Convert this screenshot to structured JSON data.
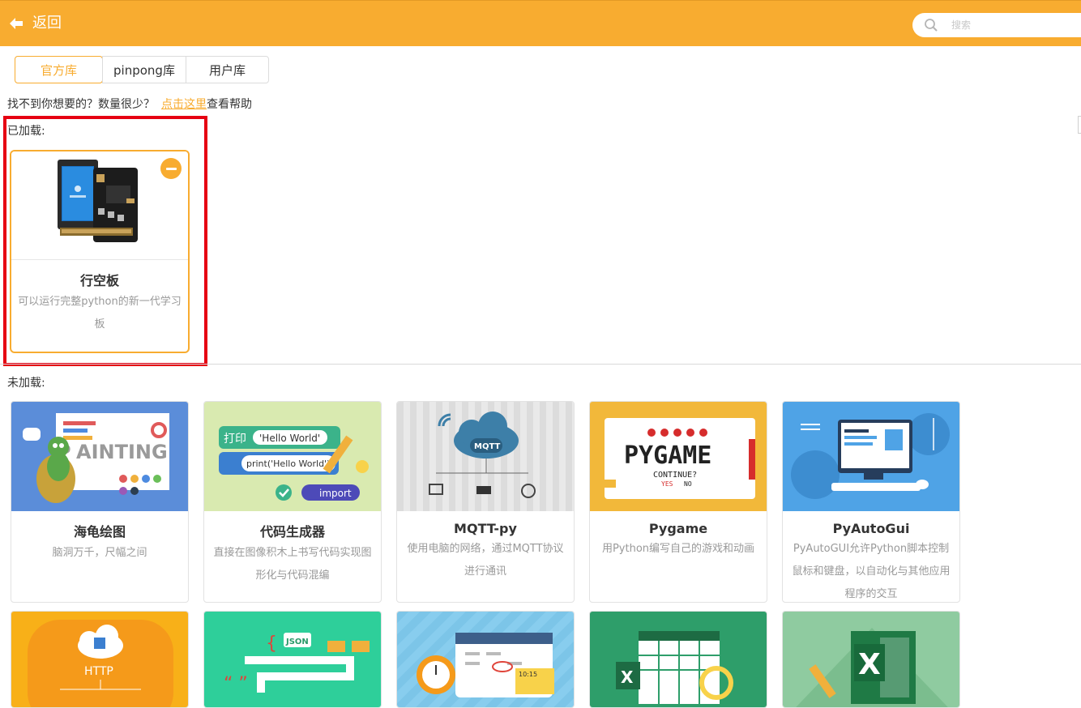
{
  "header": {
    "back_label": "返回",
    "search_placeholder": "搜索",
    "background_color": "#f8ac30"
  },
  "tabs": [
    {
      "label": "官方库",
      "active": true
    },
    {
      "label": "pinpong库",
      "active": false
    },
    {
      "label": "用户库",
      "active": false
    }
  ],
  "help": {
    "prefix": "找不到你想要的？数量很少？",
    "link": "点击这里",
    "suffix": "查看帮助"
  },
  "sections": {
    "loaded_label": "已加载:",
    "unloaded_label": "未加载:"
  },
  "loaded": [
    {
      "title": "行空板",
      "desc": "可以运行完整python的新一代学习板",
      "icon": "unihiker-board-image"
    }
  ],
  "unloaded": [
    {
      "title": "海龟绘图",
      "desc": "脑洞万千，尺幅之间",
      "icon": "turtle-painting-image"
    },
    {
      "title": "代码生成器",
      "desc": "直接在图像积木上书写代码实现图形化与代码混编",
      "icon": "code-generator-image",
      "thumb_texts": [
        "打印",
        "'Hello World'",
        "print('Hello World')",
        "import"
      ]
    },
    {
      "title": "MQTT-py",
      "desc": "使用电脑的网络，通过MQTT协议进行通讯",
      "icon": "mqtt-cloud-image",
      "thumb_texts": [
        "MQTT"
      ]
    },
    {
      "title": "Pygame",
      "desc": "用Python编写自己的游戏和动画",
      "icon": "pygame-image",
      "thumb_texts": [
        "PYGAME",
        "CONTINUE?",
        "YES",
        "NO"
      ]
    },
    {
      "title": "PyAutoGui",
      "desc": "PyAutoGUI允许Python脚本控制鼠标和键盘，以自动化与其他应用程序的交互",
      "icon": "pyautogui-image"
    },
    {
      "title": "",
      "desc": "",
      "icon": "http-image",
      "thumb_texts": [
        "HTTP"
      ]
    },
    {
      "title": "",
      "desc": "",
      "icon": "json-image",
      "thumb_texts": [
        "JSON"
      ]
    },
    {
      "title": "",
      "desc": "",
      "icon": "calendar-clock-image",
      "thumb_texts": [
        "10:15"
      ]
    },
    {
      "title": "",
      "desc": "",
      "icon": "excel-search-image"
    },
    {
      "title": "",
      "desc": "",
      "icon": "excel-image"
    }
  ]
}
